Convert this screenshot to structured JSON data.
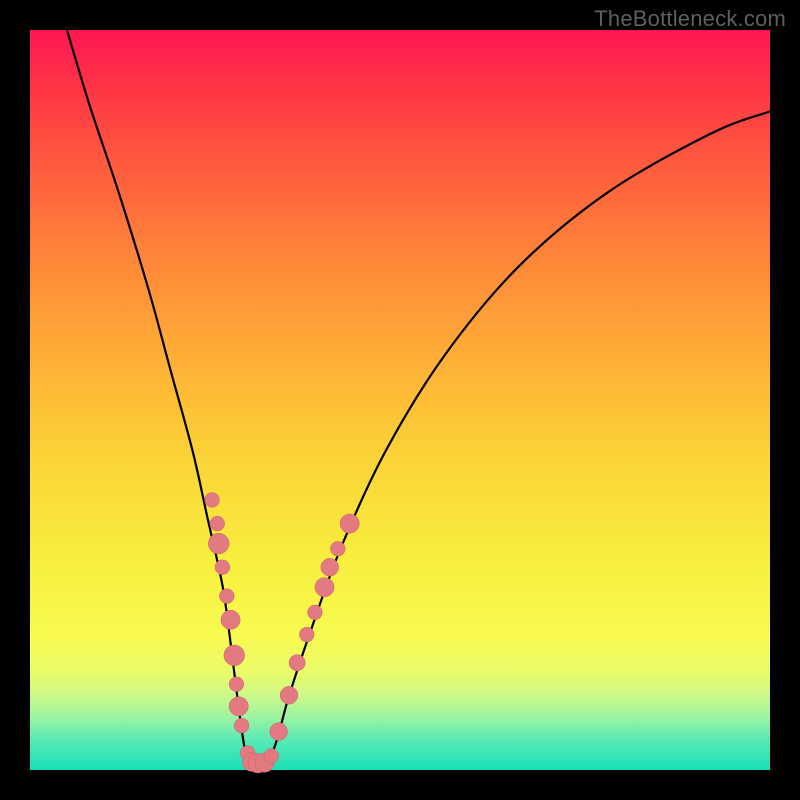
{
  "watermark": "TheBottleneck.com",
  "colors": {
    "curve_stroke": "#000000",
    "marker_fill": "#e47a81",
    "marker_stroke": "#cb6169",
    "background_black": "#000000"
  },
  "chart_data": {
    "type": "line",
    "title": "",
    "xlabel": "",
    "ylabel": "",
    "xlim": [
      0,
      100
    ],
    "ylim": [
      0,
      100
    ],
    "series": [
      {
        "name": "bottleneck-curve",
        "x": [
          5,
          8,
          12,
          16,
          19,
          22,
          24,
          26,
          27,
          28,
          29,
          30,
          31,
          33,
          35,
          38,
          42,
          48,
          56,
          66,
          78,
          92,
          100
        ],
        "y": [
          100,
          90,
          78,
          65,
          54,
          43,
          34,
          25,
          18,
          10,
          3,
          0,
          0,
          3,
          10,
          19,
          30,
          43,
          56,
          68,
          78,
          86,
          89
        ]
      }
    ],
    "markers": {
      "name": "scatter-dots",
      "points": [
        {
          "x": 24.6,
          "y": 36.5,
          "r": 1.0
        },
        {
          "x": 25.3,
          "y": 33.3,
          "r": 1.0
        },
        {
          "x": 25.5,
          "y": 30.6,
          "r": 1.4
        },
        {
          "x": 26.0,
          "y": 27.4,
          "r": 1.0
        },
        {
          "x": 26.6,
          "y": 23.5,
          "r": 1.0
        },
        {
          "x": 27.1,
          "y": 20.3,
          "r": 1.3
        },
        {
          "x": 27.6,
          "y": 15.5,
          "r": 1.4
        },
        {
          "x": 27.9,
          "y": 11.6,
          "r": 1.0
        },
        {
          "x": 28.2,
          "y": 8.6,
          "r": 1.3
        },
        {
          "x": 28.6,
          "y": 6.0,
          "r": 1.0
        },
        {
          "x": 29.4,
          "y": 2.3,
          "r": 1.0
        },
        {
          "x": 30.0,
          "y": 1.1,
          "r": 1.3
        },
        {
          "x": 30.8,
          "y": 0.9,
          "r": 1.3
        },
        {
          "x": 31.7,
          "y": 1.0,
          "r": 1.3
        },
        {
          "x": 32.6,
          "y": 1.9,
          "r": 1.0
        },
        {
          "x": 33.6,
          "y": 5.2,
          "r": 1.2
        },
        {
          "x": 35.0,
          "y": 10.1,
          "r": 1.2
        },
        {
          "x": 36.1,
          "y": 14.5,
          "r": 1.1
        },
        {
          "x": 37.4,
          "y": 18.3,
          "r": 1.0
        },
        {
          "x": 38.5,
          "y": 21.3,
          "r": 1.0
        },
        {
          "x": 39.8,
          "y": 24.7,
          "r": 1.3
        },
        {
          "x": 40.5,
          "y": 27.4,
          "r": 1.2
        },
        {
          "x": 41.6,
          "y": 29.9,
          "r": 1.0
        },
        {
          "x": 43.2,
          "y": 33.3,
          "r": 1.3
        }
      ]
    },
    "gradient_stops": [
      {
        "pos": 0,
        "color": "#ff1752"
      },
      {
        "pos": 8,
        "color": "#ff3545"
      },
      {
        "pos": 18,
        "color": "#ff5a3e"
      },
      {
        "pos": 30,
        "color": "#ff8339"
      },
      {
        "pos": 44,
        "color": "#ffae36"
      },
      {
        "pos": 58,
        "color": "#fbd437"
      },
      {
        "pos": 72,
        "color": "#f8ef3e"
      },
      {
        "pos": 82,
        "color": "#f7fb51"
      },
      {
        "pos": 87,
        "color": "#e9fb6b"
      },
      {
        "pos": 90,
        "color": "#caf989"
      },
      {
        "pos": 93,
        "color": "#9af3a3"
      },
      {
        "pos": 96,
        "color": "#58e9b5"
      },
      {
        "pos": 100,
        "color": "#19dfb9"
      }
    ]
  }
}
